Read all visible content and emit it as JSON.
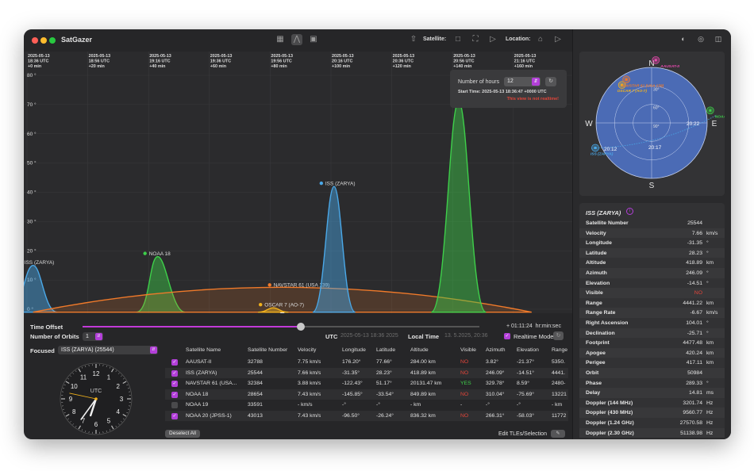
{
  "app": {
    "title": "SatGazer"
  },
  "toolbar": {
    "satellite_label": "Satellite:",
    "location_label": "Location:",
    "icons": [
      "map-icon",
      "chart-icon",
      "table-icon",
      "share-icon"
    ]
  },
  "chart": {
    "time_labels": [
      {
        "date": "2025-05-13",
        "time": "18:36 UTC",
        "offset": "+0 min"
      },
      {
        "date": "2025-05-13",
        "time": "18:56 UTC",
        "offset": "+20 min"
      },
      {
        "date": "2025-05-13",
        "time": "19:16 UTC",
        "offset": "+40 min"
      },
      {
        "date": "2025-05-13",
        "time": "19:36 UTC",
        "offset": "+60 min"
      },
      {
        "date": "2025-05-13",
        "time": "19:56 UTC",
        "offset": "+80 min"
      },
      {
        "date": "2025-05-13",
        "time": "20:16 UTC",
        "offset": "+100 min"
      },
      {
        "date": "2025-05-13",
        "time": "20:36 UTC",
        "offset": "+120 min"
      },
      {
        "date": "2025-05-13",
        "time": "20:56 UTC",
        "offset": "+140 min"
      },
      {
        "date": "2025-05-13",
        "time": "21:16 UTC",
        "offset": "+160 min"
      }
    ],
    "y_ticks": [
      "80 °",
      "70 °",
      "60 °",
      "50 °",
      "40 °",
      "30 °",
      "20 °",
      "10 °",
      "0 °"
    ],
    "passes": [
      {
        "name": "ISS (ZARYA)",
        "color": "#4aa8e8",
        "start_min": -6,
        "peak_min": 2,
        "end_min": 10,
        "peak_elev": 15
      },
      {
        "name": "NOAA 18",
        "color": "#3ecf4a",
        "start_min": 36,
        "peak_min": 43,
        "end_min": 52,
        "peak_elev": 18
      },
      {
        "name": "NAVSTAR 61 (USA 139)",
        "color": "#f07a2a",
        "start_min": 2,
        "peak_min": 84,
        "end_min": 166,
        "peak_elev": 7.5
      },
      {
        "name": "OSCAR 7 (AO-7)",
        "color": "#f2b21c",
        "start_min": 76,
        "peak_min": 81,
        "end_min": 86,
        "peak_elev": 0.5
      },
      {
        "name": "ISS (ZARYA)",
        "color": "#4aa8e8",
        "start_min": 94,
        "peak_min": 101,
        "end_min": 108,
        "peak_elev": 42
      },
      {
        "name": "",
        "color": "#3ecf4a",
        "start_min": 133,
        "peak_min": 142,
        "end_min": 151,
        "peak_elev": 71
      }
    ],
    "hours_panel": {
      "label": "Number of hours",
      "value": "12",
      "start_time": "Start Time: 2025-05-13 18:36:47 +0000 UTC",
      "warning": "This view is not realtime!"
    }
  },
  "controls": {
    "time_offset_label": "Time Offset",
    "orbits_label": "Number of Orbits",
    "orbits_value": "1",
    "offset_value": "+ 01:11:24",
    "offset_format": "hr:min:sec",
    "utc_label": "UTC",
    "utc_value": "2025-05-13 18:36 2025",
    "local_label": "Local Time",
    "local_value": "13. 5.2025, 20:36",
    "realtime_label": "Realtime Mode",
    "time_offset_fraction": 0.55
  },
  "focus": {
    "label": "Focused",
    "value": "ISS (ZARYA) (25544)"
  },
  "clock": {
    "label": "UTC",
    "numbers": [
      "12",
      "1",
      "2",
      "3",
      "4",
      "5",
      "6",
      "7",
      "8",
      "9",
      "10",
      "11"
    ],
    "hour": 6.6,
    "minute": 36,
    "second": 47
  },
  "table": {
    "headers": [
      "Satellite Name",
      "Satellite Number",
      "Velocity",
      "Longitude",
      "Latitude",
      "Altitude",
      "Visible",
      "Azimuth",
      "Elevation",
      "Range"
    ],
    "rows": [
      {
        "checked": true,
        "name": "AAUSAT-II",
        "number": "32788",
        "velocity": "7.75 km/s",
        "lon": "176.20°",
        "lat": "77.66°",
        "alt": "284.00 km",
        "visible": "NO",
        "az": "3.82°",
        "el": "-21.37°",
        "range": "5350."
      },
      {
        "checked": true,
        "name": "ISS (ZARYA)",
        "number": "25544",
        "velocity": "7.66 km/s",
        "lon": "-31.35°",
        "lat": "28.23°",
        "alt": "418.89 km",
        "visible": "NO",
        "az": "246.09°",
        "el": "-14.51°",
        "range": "4441."
      },
      {
        "checked": true,
        "name": "NAVSTAR 61 (USA...",
        "number": "32384",
        "velocity": "3.88 km/s",
        "lon": "-122.43°",
        "lat": "51.17°",
        "alt": "20131.47 km",
        "visible": "YES",
        "az": "329.78°",
        "el": "8.59°",
        "range": "2480-"
      },
      {
        "checked": true,
        "name": "NOAA 18",
        "number": "28654",
        "velocity": "7.43 km/s",
        "lon": "-145.85°",
        "lat": "-33.54°",
        "alt": "849.89 km",
        "visible": "NO",
        "az": "310.04°",
        "el": "-75.69°",
        "range": "13221"
      },
      {
        "checked": false,
        "name": "NOAA 19",
        "number": "33591",
        "velocity": "- km/s",
        "lon": "-°",
        "lat": "-°",
        "alt": "- km",
        "visible": "-",
        "az": "-°",
        "el": "-°",
        "range": "- km"
      },
      {
        "checked": true,
        "name": "NOAA 20 (JPSS-1)",
        "number": "43013",
        "velocity": "7.43 km/s",
        "lon": "-96.50°",
        "lat": "-26.24°",
        "alt": "836.32 km",
        "visible": "NO",
        "az": "266.31°",
        "el": "-58.03°",
        "range": "11772"
      }
    ],
    "deselect_label": "Deselect All",
    "edit_label": "Edit TLEs/Selection"
  },
  "polar": {
    "directions": {
      "n": "N",
      "e": "E",
      "s": "S",
      "w": "W"
    },
    "rings": [
      "30°",
      "60°",
      "90°"
    ],
    "satellites": [
      {
        "name": "AAUSAT-II",
        "color": "#e84ab0",
        "az": 3.82,
        "el": -21.37
      },
      {
        "name": "OSCAR 7 (AO-7)",
        "color": "#f2b21c",
        "az": 322,
        "el": 12
      },
      {
        "name": "NAVSTAR 61 (USA 139)",
        "color": "#f07a2a",
        "az": 329.78,
        "el": 8.59
      },
      {
        "name": "NOAA 18",
        "color": "#3ecf4a",
        "az": 78,
        "el": -6
      },
      {
        "name": "ISS (ZARYA)",
        "color": "#4aa8e8",
        "az": 246.09,
        "el": -14.51
      }
    ],
    "time_labels": [
      "20:22",
      "20:12",
      "20:17"
    ]
  },
  "info": {
    "title": "ISS (ZARYA)",
    "rows": [
      {
        "k": "Satellite Number",
        "v": "25544",
        "u": ""
      },
      {
        "k": "Velocity",
        "v": "7.66",
        "u": "km/s"
      },
      {
        "k": "Longitude",
        "v": "-31.35",
        "u": "°"
      },
      {
        "k": "Latitude",
        "v": "28.23",
        "u": "°"
      },
      {
        "k": "Altitude",
        "v": "418.89",
        "u": "km"
      },
      {
        "k": "Azimuth",
        "v": "246.09",
        "u": "°"
      },
      {
        "k": "Elevation",
        "v": "-14.51",
        "u": "°"
      },
      {
        "k": "Visible",
        "v": "NO",
        "u": ""
      },
      {
        "k": "Range",
        "v": "4441.22",
        "u": "km"
      },
      {
        "k": "Range Rate",
        "v": "-6.67",
        "u": "km/s"
      },
      {
        "k": "Right Ascension",
        "v": "104.01",
        "u": "°"
      },
      {
        "k": "Declination",
        "v": "-25.71",
        "u": "°"
      },
      {
        "k": "Footprint",
        "v": "4477.48",
        "u": "km"
      },
      {
        "k": "Apogee",
        "v": "420.24",
        "u": "km"
      },
      {
        "k": "Perigee",
        "v": "417.11",
        "u": "km"
      },
      {
        "k": "Orbit",
        "v": "50984",
        "u": ""
      },
      {
        "k": "Phase",
        "v": "289.33",
        "u": "°"
      },
      {
        "k": "Delay",
        "v": "14.81",
        "u": "ms"
      },
      {
        "k": "Doppler (144 MHz)",
        "v": "3201.74",
        "u": "Hz"
      },
      {
        "k": "Doppler (430 MHz)",
        "v": "9560.77",
        "u": "Hz"
      },
      {
        "k": "Doppler (1.24 GHz)",
        "v": "27570.58",
        "u": "Hz"
      },
      {
        "k": "Doppler (2.30 GHz)",
        "v": "51138.98",
        "u": "Hz"
      }
    ]
  },
  "colors": {
    "accent": "#b33fd9",
    "no": "#e0453a",
    "yes": "#3ecf4a"
  }
}
